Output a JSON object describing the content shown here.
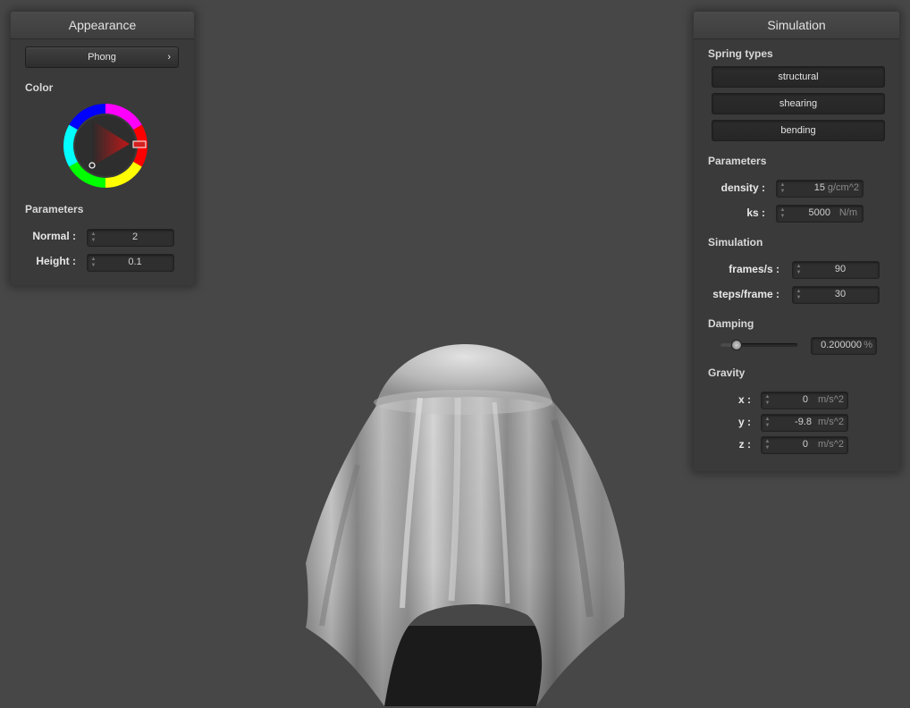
{
  "appearance": {
    "title": "Appearance",
    "shader_select": {
      "value": "Phong",
      "arrow": "›"
    },
    "color_label": "Color",
    "params_label": "Parameters",
    "normal_label": "Normal :",
    "normal_value": "2",
    "height_label": "Height :",
    "height_value": "0.1"
  },
  "simulation": {
    "title": "Simulation",
    "spring_types_label": "Spring types",
    "spring_buttons": [
      "structural",
      "shearing",
      "bending"
    ],
    "params_label": "Parameters",
    "density_label": "density :",
    "density_value": "15",
    "density_unit": "g/cm^2",
    "ks_label": "ks :",
    "ks_value": "5000",
    "ks_unit": "N/m",
    "sim_label": "Simulation",
    "fps_label": "frames/s :",
    "fps_value": "90",
    "steps_label": "steps/frame :",
    "steps_value": "30",
    "damping_label": "Damping",
    "damping_value": "0.200000",
    "damping_unit": "%",
    "damping_fraction": 0.2,
    "gravity_label": "Gravity",
    "gx_label": "x :",
    "gx_value": "0",
    "gy_label": "y :",
    "gy_value": "-9.8",
    "gz_label": "z :",
    "gz_value": "0",
    "g_unit": "m/s^2"
  },
  "colors": {
    "background": "#474747",
    "panel": "#3a3a3a",
    "selected_color": "#a01010"
  }
}
